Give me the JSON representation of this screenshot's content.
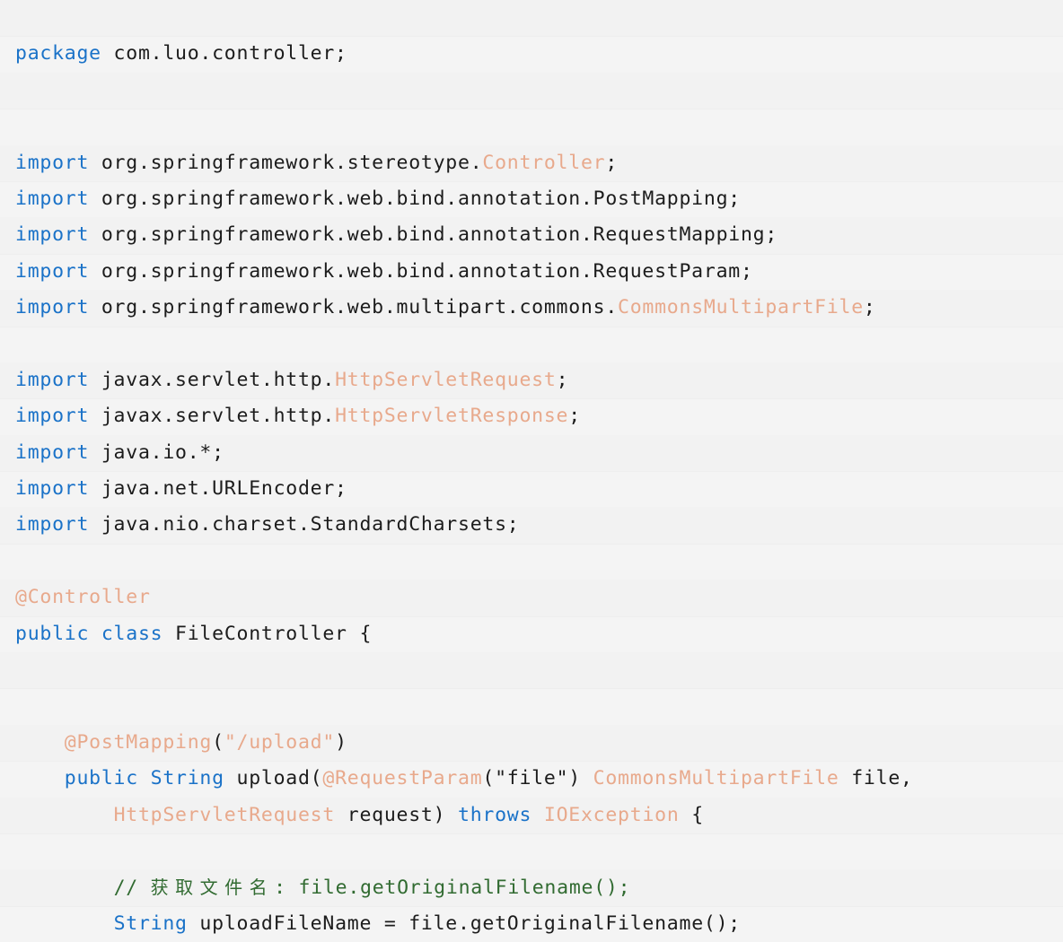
{
  "editor": {
    "language": "java",
    "file_name": "FileController.java",
    "background_color": "#f2f2f2",
    "band_color": "#f4f4f4",
    "colors": {
      "keyword": "#1a72c8",
      "type": "#e8a98c",
      "plain": "#1c1c1c",
      "comment": "#316b31"
    }
  },
  "code": {
    "lines": [
      {
        "band": false,
        "tokens": []
      },
      {
        "band": true,
        "tokens": [
          {
            "t": "package",
            "c": "kw"
          },
          {
            "t": " com.luo.controller;",
            "c": "txt"
          }
        ]
      },
      {
        "band": false,
        "tokens": []
      },
      {
        "band": true,
        "tokens": []
      },
      {
        "band": false,
        "tokens": [
          {
            "t": "import",
            "c": "kw"
          },
          {
            "t": " org.springframework.stereotype.",
            "c": "txt"
          },
          {
            "t": "Controller",
            "c": "type"
          },
          {
            "t": ";",
            "c": "txt"
          }
        ]
      },
      {
        "band": true,
        "tokens": [
          {
            "t": "import",
            "c": "kw"
          },
          {
            "t": " org.springframework.web.bind.annotation.PostMapping;",
            "c": "txt"
          }
        ]
      },
      {
        "band": false,
        "tokens": [
          {
            "t": "import",
            "c": "kw"
          },
          {
            "t": " org.springframework.web.bind.annotation.RequestMapping;",
            "c": "txt"
          }
        ]
      },
      {
        "band": true,
        "tokens": [
          {
            "t": "import",
            "c": "kw"
          },
          {
            "t": " org.springframework.web.bind.annotation.RequestParam;",
            "c": "txt"
          }
        ]
      },
      {
        "band": false,
        "tokens": [
          {
            "t": "import",
            "c": "kw"
          },
          {
            "t": " org.springframework.web.multipart.commons.",
            "c": "txt"
          },
          {
            "t": "CommonsMultipartFile",
            "c": "type"
          },
          {
            "t": ";",
            "c": "txt"
          }
        ]
      },
      {
        "band": true,
        "tokens": []
      },
      {
        "band": false,
        "tokens": [
          {
            "t": "import",
            "c": "kw"
          },
          {
            "t": " javax.servlet.http.",
            "c": "txt"
          },
          {
            "t": "HttpServletRequest",
            "c": "type"
          },
          {
            "t": ";",
            "c": "txt"
          }
        ]
      },
      {
        "band": true,
        "tokens": [
          {
            "t": "import",
            "c": "kw"
          },
          {
            "t": " javax.servlet.http.",
            "c": "txt"
          },
          {
            "t": "HttpServletResponse",
            "c": "type"
          },
          {
            "t": ";",
            "c": "txt"
          }
        ]
      },
      {
        "band": false,
        "tokens": [
          {
            "t": "import",
            "c": "kw"
          },
          {
            "t": " java.io.*;",
            "c": "txt"
          }
        ]
      },
      {
        "band": true,
        "tokens": [
          {
            "t": "import",
            "c": "kw"
          },
          {
            "t": " java.net.URLEncoder;",
            "c": "txt"
          }
        ]
      },
      {
        "band": false,
        "tokens": [
          {
            "t": "import",
            "c": "kw"
          },
          {
            "t": " java.nio.charset.StandardCharsets;",
            "c": "txt"
          }
        ]
      },
      {
        "band": true,
        "tokens": []
      },
      {
        "band": false,
        "tokens": [
          {
            "t": "@Controller",
            "c": "type"
          }
        ]
      },
      {
        "band": true,
        "tokens": [
          {
            "t": "public class",
            "c": "kw"
          },
          {
            "t": " FileController {",
            "c": "txt"
          }
        ]
      },
      {
        "band": false,
        "tokens": []
      },
      {
        "band": true,
        "tokens": []
      },
      {
        "band": false,
        "tokens": [
          {
            "t": "    ",
            "c": "txt"
          },
          {
            "t": "@PostMapping",
            "c": "type"
          },
          {
            "t": "(",
            "c": "txt"
          },
          {
            "t": "\"/upload\"",
            "c": "type"
          },
          {
            "t": ")",
            "c": "txt"
          }
        ]
      },
      {
        "band": true,
        "tokens": [
          {
            "t": "    ",
            "c": "txt"
          },
          {
            "t": "public String",
            "c": "kw"
          },
          {
            "t": " upload(",
            "c": "txt"
          },
          {
            "t": "@RequestParam",
            "c": "type"
          },
          {
            "t": "(\"file\") ",
            "c": "txt"
          },
          {
            "t": "CommonsMultipartFile",
            "c": "type"
          },
          {
            "t": " file,",
            "c": "txt"
          }
        ]
      },
      {
        "band": false,
        "tokens": [
          {
            "t": "        ",
            "c": "txt"
          },
          {
            "t": "HttpServletRequest",
            "c": "type"
          },
          {
            "t": " request) ",
            "c": "txt"
          },
          {
            "t": "throws",
            "c": "kw"
          },
          {
            "t": " ",
            "c": "txt"
          },
          {
            "t": "IOException",
            "c": "type"
          },
          {
            "t": " {",
            "c": "txt"
          }
        ]
      },
      {
        "band": true,
        "tokens": []
      },
      {
        "band": false,
        "tokens": [
          {
            "t": "        ",
            "c": "txt"
          },
          {
            "t": "// ",
            "c": "cmt"
          },
          {
            "t": "获取文件名",
            "c": "cmt",
            "cjk": true
          },
          {
            "t": ": file.getOriginalFilename();",
            "c": "cmt"
          }
        ]
      },
      {
        "band": true,
        "tokens": [
          {
            "t": "        ",
            "c": "txt"
          },
          {
            "t": "String",
            "c": "kw"
          },
          {
            "t": " uploadFileName = file.getOriginalFilename();",
            "c": "txt"
          }
        ]
      }
    ]
  }
}
